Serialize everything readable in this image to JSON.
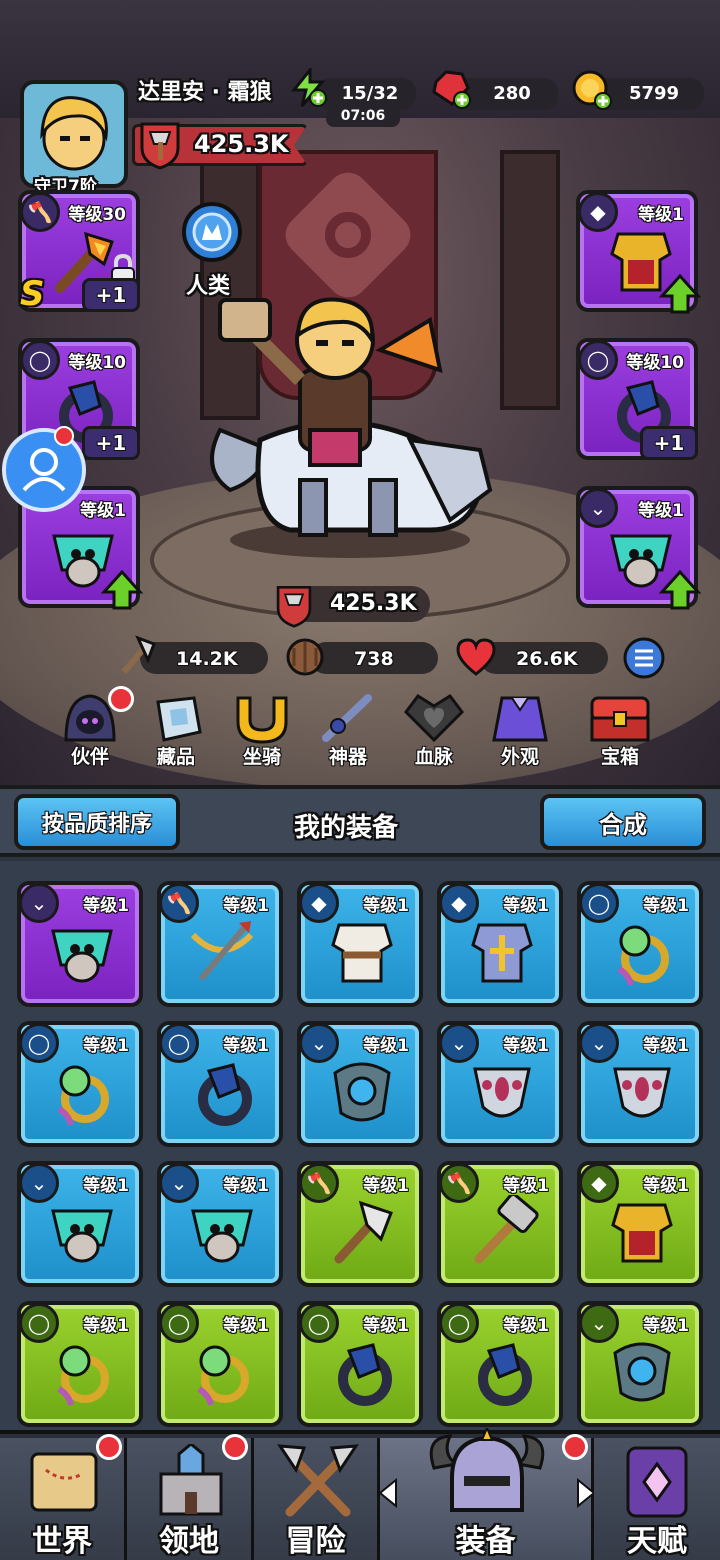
{
  "header": {
    "player_name": "达里安 · 霜狼",
    "rank_label": "守卫7阶",
    "power": "425.3K",
    "stamina": "15/32",
    "stamina_timer": "07:06",
    "gems": "280",
    "gold": "5799"
  },
  "race": {
    "label": "人类"
  },
  "left_slots": [
    {
      "level": "等级30",
      "plus": "+1",
      "rarity": "S",
      "item": "axe",
      "color": "purple"
    },
    {
      "level": "等级10",
      "plus": "+1",
      "item": "ring",
      "color": "purple"
    },
    {
      "level": "等级1",
      "item": "amulet",
      "color": "purple"
    }
  ],
  "right_slots": [
    {
      "level": "等级1",
      "item": "armor",
      "color": "purple"
    },
    {
      "level": "等级10",
      "plus": "+1",
      "item": "ring",
      "color": "purple"
    },
    {
      "level": "等级1",
      "item": "amulet",
      "color": "purple"
    }
  ],
  "hero_power": "425.3K",
  "stats": {
    "attack": "14.2K",
    "defense": "738",
    "hp": "26.6K"
  },
  "feature_nav": [
    {
      "label": "伙伴",
      "icon": "hooded-companion-icon"
    },
    {
      "label": "藏品",
      "icon": "crystal-collection-icon"
    },
    {
      "label": "坐骑",
      "icon": "horseshoe-mount-icon"
    },
    {
      "label": "神器",
      "icon": "artifact-sword-icon"
    },
    {
      "label": "血脉",
      "icon": "bloodline-heart-icon"
    },
    {
      "label": "外观",
      "icon": "cape-appearance-icon"
    },
    {
      "label": "宝箱",
      "icon": "treasure-chest-icon"
    }
  ],
  "panel": {
    "sort_button": "按品质排序",
    "title": "我的装备",
    "merge_button": "合成"
  },
  "inventory": [
    {
      "level": "等级1",
      "color": "purple",
      "item": "amulet",
      "type": "amulet"
    },
    {
      "level": "等级1",
      "color": "blue",
      "item": "crossbow",
      "type": "weapon"
    },
    {
      "level": "等级1",
      "color": "blue",
      "item": "leather-armor",
      "type": "armor"
    },
    {
      "level": "等级1",
      "color": "blue",
      "item": "plate-armor",
      "type": "armor"
    },
    {
      "level": "等级1",
      "color": "blue",
      "item": "green-ring",
      "type": "ring"
    },
    {
      "level": "等级1",
      "color": "blue",
      "item": "green-ring",
      "type": "ring"
    },
    {
      "level": "等级1",
      "color": "blue",
      "item": "dark-ring",
      "type": "ring"
    },
    {
      "level": "等级1",
      "color": "blue",
      "item": "blue-pendant",
      "type": "amulet"
    },
    {
      "level": "等级1",
      "color": "blue",
      "item": "gem-pendant",
      "type": "amulet"
    },
    {
      "level": "等级1",
      "color": "blue",
      "item": "gem-pendant",
      "type": "amulet"
    },
    {
      "level": "等级1",
      "color": "blue",
      "item": "amulet",
      "type": "amulet"
    },
    {
      "level": "等级1",
      "color": "blue",
      "item": "amulet",
      "type": "amulet"
    },
    {
      "level": "等级1",
      "color": "green",
      "item": "axe",
      "type": "weapon"
    },
    {
      "level": "等级1",
      "color": "green",
      "item": "hammer",
      "type": "weapon"
    },
    {
      "level": "等级1",
      "color": "green",
      "item": "armor",
      "type": "armor"
    },
    {
      "level": "等级1",
      "color": "green",
      "item": "green-ring",
      "type": "ring"
    },
    {
      "level": "等级1",
      "color": "green",
      "item": "green-ring",
      "type": "ring"
    },
    {
      "level": "等级1",
      "color": "green",
      "item": "dark-ring",
      "type": "ring"
    },
    {
      "level": "等级1",
      "color": "green",
      "item": "dark-ring",
      "type": "ring"
    },
    {
      "level": "等级1",
      "color": "green",
      "item": "blue-pendant",
      "type": "amulet"
    }
  ],
  "bottom_nav": [
    {
      "label": "世界",
      "icon": "world-map-icon",
      "badge": true
    },
    {
      "label": "领地",
      "icon": "castle-icon",
      "badge": true
    },
    {
      "label": "冒险",
      "icon": "crossed-axes-icon",
      "badge": false
    },
    {
      "label": "装备",
      "icon": "horned-helmet-icon",
      "badge": true,
      "active": true
    },
    {
      "label": "天赋",
      "icon": "spellbook-icon",
      "badge": false
    }
  ],
  "colors": {
    "purple": "#8a30d6",
    "blue": "#2ea3df",
    "green": "#84c21f",
    "red": "#e8333a"
  }
}
